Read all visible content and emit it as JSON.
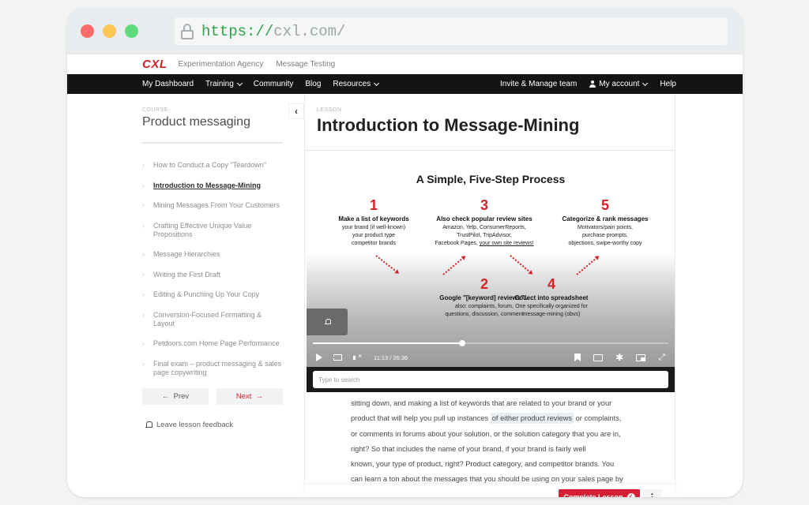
{
  "browser": {
    "url_scheme": "https://",
    "url_host": "cxl.com/"
  },
  "topbar": {
    "logo": "CXL",
    "links": [
      "Experimentation Agency",
      "Message Testing"
    ]
  },
  "navbar": {
    "left": [
      {
        "label": "My Dashboard",
        "dropdown": false
      },
      {
        "label": "Training",
        "dropdown": true
      },
      {
        "label": "Community",
        "dropdown": false
      },
      {
        "label": "Blog",
        "dropdown": false
      },
      {
        "label": "Resources",
        "dropdown": true
      }
    ],
    "right": {
      "invite": "Invite & Manage team",
      "account": "My account",
      "help": "Help"
    }
  },
  "sidebar": {
    "course_label": "COURSE",
    "course_title": "Product messaging",
    "lessons": [
      {
        "title": "How to Conduct a Copy \"Teardown\"",
        "active": false
      },
      {
        "title": "Introduction to Message-Mining",
        "active": true
      },
      {
        "title": "Mining Messages From Your Customers",
        "active": false
      },
      {
        "title": "Crafting Effective Unique Value Propositions",
        "active": false
      },
      {
        "title": "Message Hierarchies",
        "active": false
      },
      {
        "title": "Writing the First Draft",
        "active": false
      },
      {
        "title": "Editing & Punching Up Your Copy",
        "active": false
      },
      {
        "title": "Conversion-Focused Formatting & Layout",
        "active": false
      },
      {
        "title": "Petdoors.com Home Page Performance",
        "active": false
      },
      {
        "title": "Final exam – product messaging & sales page copywriting",
        "active": false
      }
    ],
    "prev_label": "Prev",
    "next_label": "Next",
    "feedback_label": "Leave lesson feedback"
  },
  "lesson": {
    "label": "LESSON",
    "title": "Introduction to Message-Mining"
  },
  "video": {
    "slide_title": "A Simple, Five-Step Process",
    "steps": [
      {
        "num": "1",
        "head": "Make a list of keywords",
        "lines": [
          "your brand (if well-known)",
          "your product type",
          "competitor brands"
        ]
      },
      {
        "num": "2",
        "head": "Google \"[keyword] reviews\"...",
        "lines": [
          "also: complaints, forum,",
          "questions, discussion, comment"
        ]
      },
      {
        "num": "3",
        "head": "Also check popular review sites",
        "lines": [
          "Amazon, Yelp, ConsumerReports,",
          "TrustPilot, TripAdvisor,",
          "Facebook Pages, "
        ],
        "underlined": "your own site reviews!"
      },
      {
        "num": "4",
        "head": "Collect into spreadsheet",
        "lines": [
          "One specifically organized for",
          "message-mining (obvs)"
        ]
      },
      {
        "num": "5",
        "head": "Categorize & rank messages",
        "lines": [
          "Motivators/pain points,",
          "purchase prompts,",
          "objections, swipe-worthy copy"
        ]
      }
    ],
    "current_time": "11:13",
    "duration": "26:36",
    "time_display": "11:13 / 26:36",
    "progress_fraction": 0.42
  },
  "transcript": {
    "search_placeholder": "Type to search",
    "lines": [
      "sitting down,  and making a list of keywords  that are related to your brand or your",
      "product  that will help you pull up instances ",
      "or comments in forums  about your solution,  or the solution category that you are in,",
      "right?  So that includes the name of your brand,  if your brand is fairly well",
      "known,  your type of product, right?  Product category, and competitor brands.  You",
      "can learn a ton about the messages  that you should be using on your sales page  by"
    ],
    "highlight": "of either product reviews",
    "line2_tail": " or complaints,"
  },
  "footer": {
    "complete_label": "Complete Lesson"
  },
  "colors": {
    "brand_red": "#d1232a",
    "complete_red": "#d41f34",
    "nav_bg": "#141414"
  }
}
